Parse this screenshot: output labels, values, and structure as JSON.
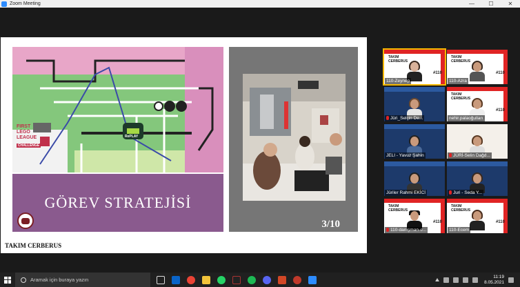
{
  "window": {
    "title": "Zoom Meeting",
    "controls": [
      "—",
      "☐",
      "✕"
    ]
  },
  "slide": {
    "title": "GÖREV STRATEJİSİ",
    "team": "TAKIM CERBERUS",
    "page": "3/10",
    "map_texts": {
      "league": "FIRST LEGO LEAGUE",
      "challenge": "CHALLENGE",
      "replay": "RePLAY"
    }
  },
  "participants": [
    {
      "name": "110-Zeynep",
      "type": "cerberus",
      "num": "#110",
      "active": true
    },
    {
      "name": "110-Azra",
      "type": "cerberus",
      "num": "#110",
      "active": false
    },
    {
      "name": "Jüri_Selçin De...",
      "type": "blue",
      "active": false,
      "muted": true
    },
    {
      "name": "nehir.palaoğulları",
      "type": "cerberus",
      "num": "#110",
      "active": false
    },
    {
      "name": "JELI - Yavuz Şahin",
      "type": "blue",
      "active": false
    },
    {
      "name": "JÜRİ-Selin Dağd...",
      "type": "plain",
      "active": false,
      "muted": true
    },
    {
      "name": "Jüriler Rahmi EKİCİ",
      "type": "blue",
      "active": false
    },
    {
      "name": "Juri - Seda Y...",
      "type": "blue",
      "active": false,
      "muted": true
    },
    {
      "name": "110-danışman-e...",
      "type": "cerberus",
      "num": "#110",
      "active": false,
      "muted": true
    },
    {
      "name": "110-Ecem",
      "type": "cerberus",
      "num": "#110",
      "active": false
    }
  ],
  "cerberus_card": {
    "line1": "TAKIM",
    "line2": "CERBERUS"
  },
  "taskbar": {
    "search_placeholder": "Aramak için buraya yazın",
    "time": "11:19",
    "date": "8.05.2021"
  },
  "colors": {
    "accent": "#2d8cff",
    "slide_title_bg": "#8a5a8e",
    "cerberus_red": "#e02424",
    "active_border": "#f5b800"
  }
}
